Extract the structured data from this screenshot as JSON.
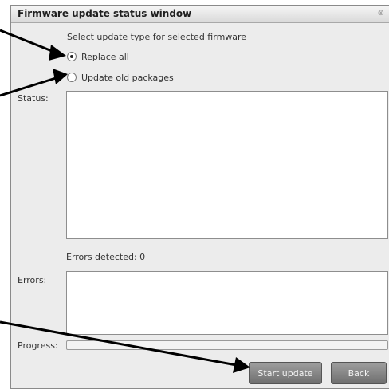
{
  "window": {
    "title": "Firmware update status window",
    "close_glyph": "⊗"
  },
  "update_type": {
    "prompt": "Select update type for selected firmware",
    "options": [
      {
        "label": "Replace all",
        "checked": true
      },
      {
        "label": "Update old packages",
        "checked": false
      }
    ]
  },
  "status": {
    "label": "Status:",
    "value": ""
  },
  "errors_detected": {
    "text": "Errors detected:  0"
  },
  "errors": {
    "label": "Errors:",
    "value": ""
  },
  "progress": {
    "label": "Progress:",
    "value": 0
  },
  "buttons": {
    "start_label": "Start update",
    "back_label": "Back"
  },
  "colors": {
    "arrow": "#000000",
    "button": "#7f7f7f"
  }
}
